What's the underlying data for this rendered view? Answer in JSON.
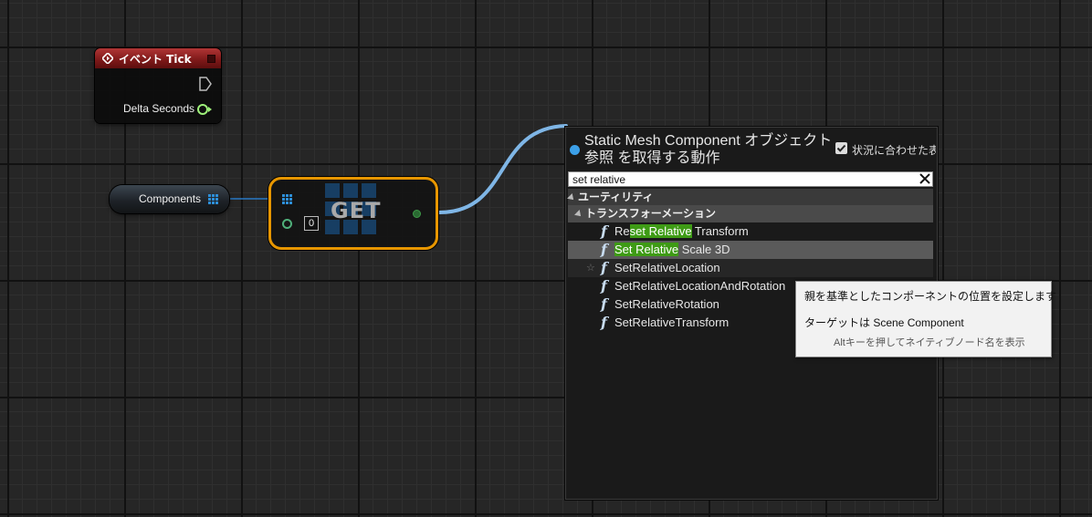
{
  "event_node": {
    "title": "イベント Tick",
    "output_label": "Delta Seconds",
    "header_color": "#8c1f1f"
  },
  "components_node": {
    "label": "Components",
    "pin_color": "#2d8fd8"
  },
  "get_node": {
    "title": "GET",
    "index_value": "0",
    "border_color": "#e79600"
  },
  "wire_color": "#7fb6e6",
  "menu": {
    "title": "Static Mesh Component オブジェクト参照 を取得する動作",
    "context_sensitive_label": "状況に合わせた表",
    "context_sensitive_checked": true,
    "search_value": "set relative",
    "categories": [
      "ユーティリティ",
      "トランスフォーメーション"
    ],
    "items": [
      {
        "pre": "Re",
        "hl": "set Relative",
        "post": " Transform"
      },
      {
        "pre": "",
        "hl": "Set Relative",
        "post": " Scale 3D"
      },
      {
        "pre": "SetRelativeLocation",
        "hl": "",
        "post": ""
      },
      {
        "pre": "SetRelativeLocationAndRotation",
        "hl": "",
        "post": ""
      },
      {
        "pre": "SetRelativeRotation",
        "hl": "",
        "post": ""
      },
      {
        "pre": "SetRelativeTransform",
        "hl": "",
        "post": ""
      }
    ],
    "highlight_color": "#3e9b15"
  },
  "tooltip": {
    "description": "親を基準としたコンポーネントの位置を設定します",
    "target": "ターゲットは Scene Component",
    "hint": "Altキーを押してネイティブノード名を表示"
  }
}
